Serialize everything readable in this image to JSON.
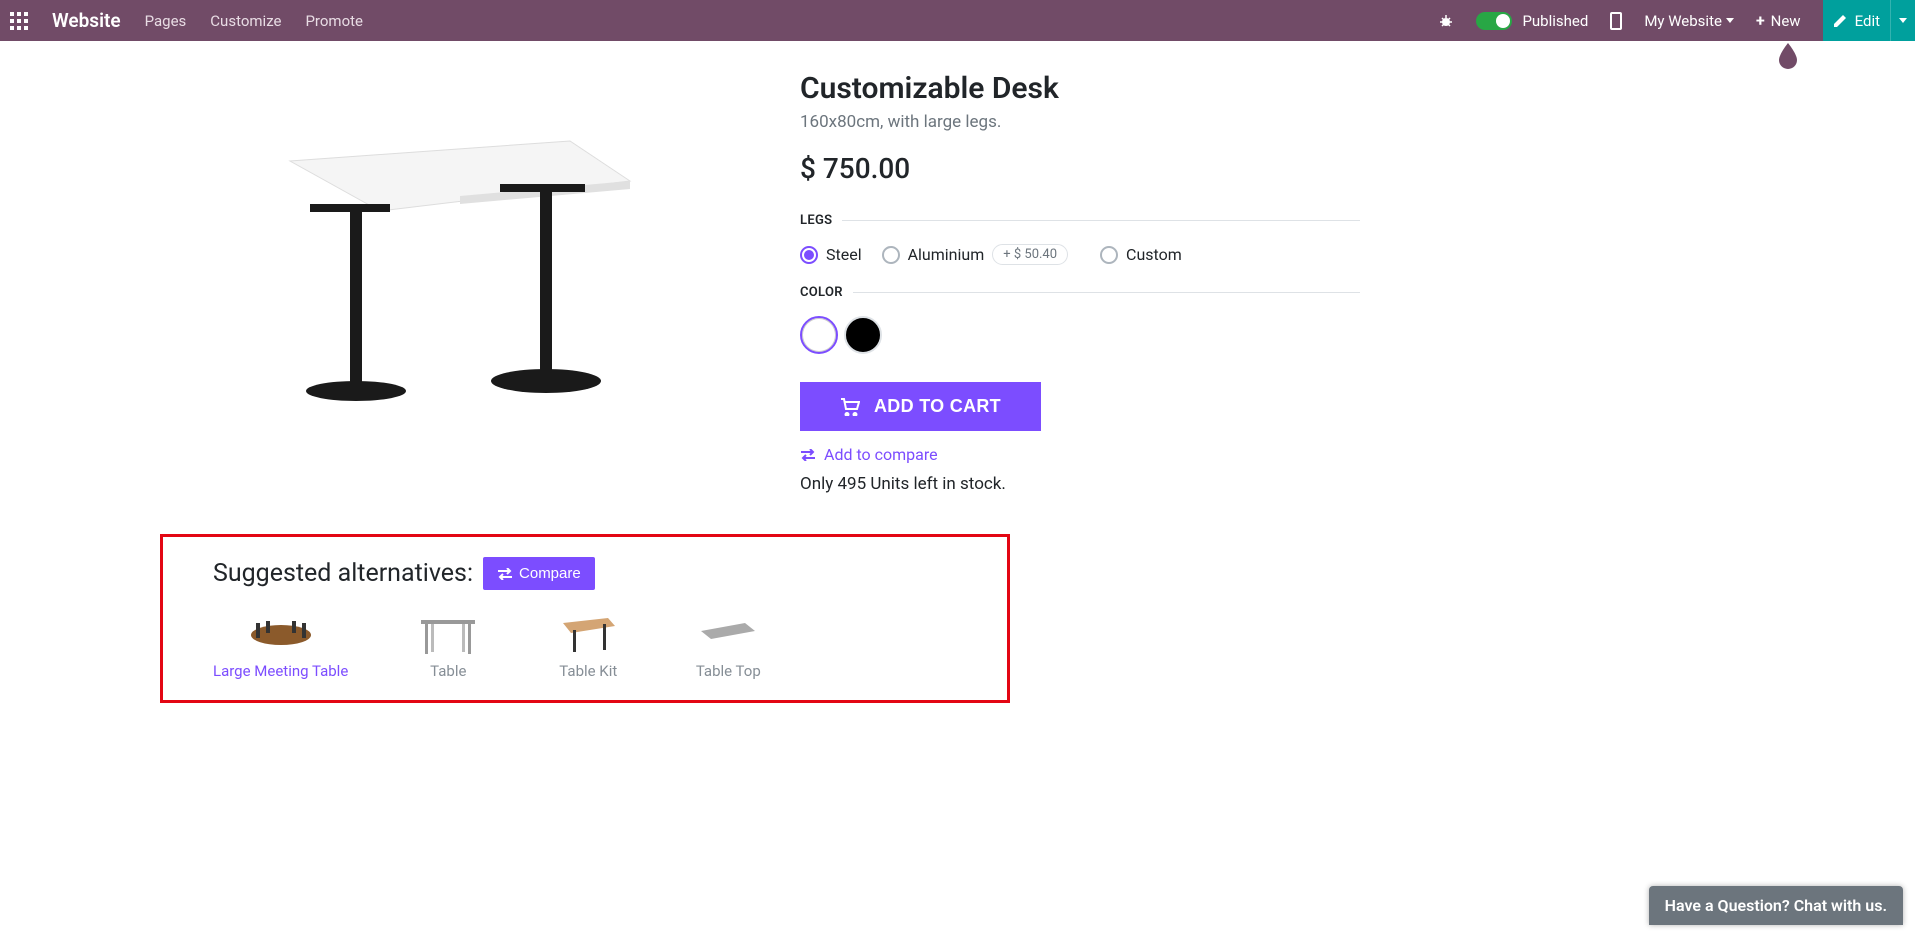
{
  "topbar": {
    "brand": "Website",
    "nav": [
      "Pages",
      "Customize",
      "Promote"
    ],
    "published": "Published",
    "mywebsite": "My Website",
    "new": "New",
    "edit": "Edit"
  },
  "product": {
    "title": "Customizable Desk",
    "subtitle": "160x80cm, with large legs.",
    "price": "$ 750.00",
    "variants": {
      "legs": {
        "label": "LEGS",
        "options": [
          {
            "label": "Steel",
            "selected": true
          },
          {
            "label": "Aluminium",
            "selected": false,
            "extra": "+  $ 50.40"
          },
          {
            "label": "Custom",
            "selected": false
          }
        ]
      },
      "color": {
        "label": "COLOR",
        "options": [
          "white",
          "black"
        ]
      }
    },
    "add_to_cart": "ADD TO CART",
    "add_to_compare": "Add to compare",
    "stock": "Only 495 Units left in stock."
  },
  "suggested": {
    "title": "Suggested alternatives:",
    "compare": "Compare",
    "items": [
      {
        "name": "Large Meeting Table",
        "muted": false
      },
      {
        "name": "Table",
        "muted": true
      },
      {
        "name": "Table Kit",
        "muted": true
      },
      {
        "name": "Table Top",
        "muted": true
      }
    ]
  },
  "chat": "Have a Question? Chat with us."
}
